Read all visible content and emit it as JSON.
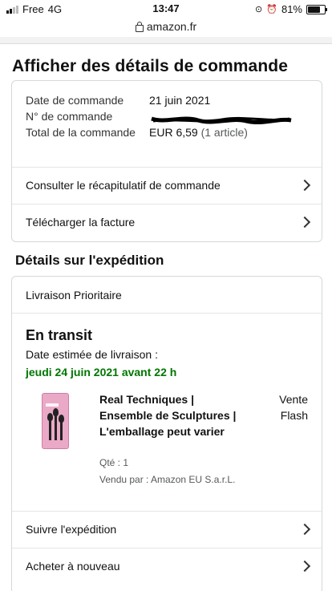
{
  "status_bar": {
    "carrier": "Free",
    "network": "4G",
    "time": "13:47",
    "battery": "81%",
    "battery_level": 0.81
  },
  "browser": {
    "url": "amazon.fr"
  },
  "page": {
    "title": "Afficher des détails de commande"
  },
  "order": {
    "date_label": "Date de commande",
    "date_value": "21 juin 2021",
    "number_label": "N° de commande",
    "total_label": "Total de la commande",
    "total_value": "EUR 6,59",
    "total_items": "(1 article)",
    "links": [
      {
        "label": "Consulter le récapitulatif de commande"
      },
      {
        "label": "Télécharger la facture"
      }
    ]
  },
  "shipment": {
    "section_title": "Détails sur l'expédition",
    "method": "Livraison Prioritaire",
    "status": "En transit",
    "estimated_label": "Date estimée de livraison :",
    "estimated_date": "jeudi 24 juin 2021 avant 22 h",
    "product": {
      "title": "Real Techniques | Ensemble de Sculptures | L'emballage peut varier",
      "tag": "Vente Flash",
      "quantity": "Qté : 1",
      "sold_by": "Vendu par : Amazon EU S.a.r.L."
    },
    "actions": [
      {
        "label": "Suivre l'expédition"
      },
      {
        "label": "Acheter à nouveau"
      }
    ]
  }
}
